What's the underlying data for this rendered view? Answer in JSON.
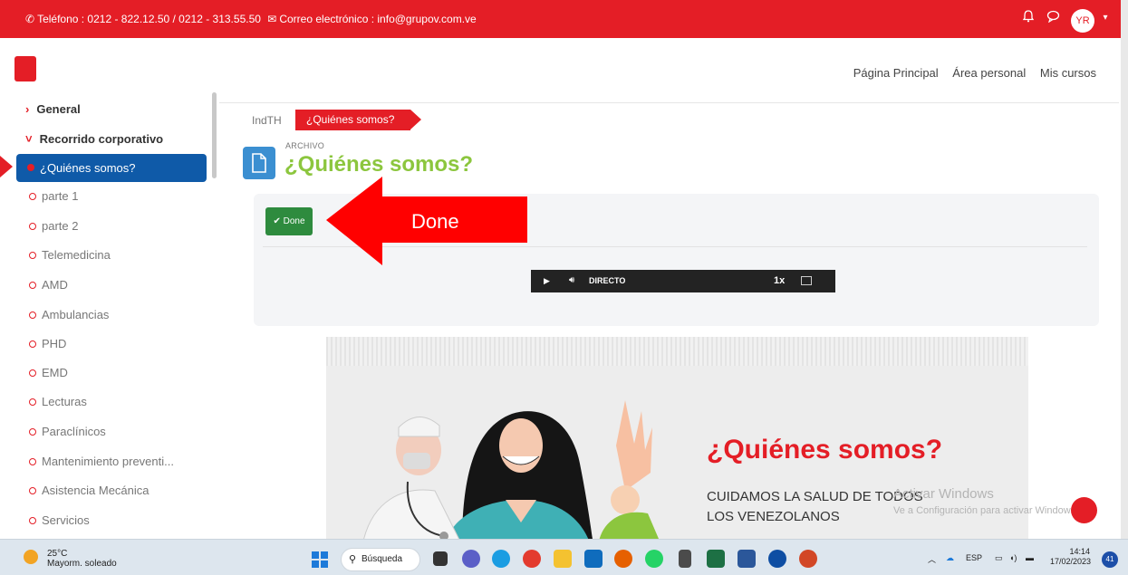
{
  "topbar": {
    "contact": "Teléfono : 0212 - 822.12.50 / 0212 - 313.55.50",
    "email": "Correo electrónico : info@grupov.com.ve",
    "avatar": "YR"
  },
  "nav": {
    "home": "Página Principal",
    "personal": "Área personal",
    "courses": "Mis cursos"
  },
  "sidebar": {
    "sections": [
      "General",
      "Recorrido corporativo"
    ],
    "active": "¿Quiénes somos?",
    "items": [
      "parte 1",
      "parte 2",
      "Telemedicina",
      "AMD",
      "Ambulancias",
      "PHD",
      "EMD",
      "Lecturas",
      "Paraclínicos",
      "Mantenimiento preventi...",
      "Asistencia Mecánica",
      "Servicios"
    ]
  },
  "breadcrumb": {
    "course": "IndTH",
    "current": "¿Quiénes somos?"
  },
  "page": {
    "type_label": "ARCHIVO",
    "title": "¿Quiénes somos?"
  },
  "activity": {
    "done_label": "✔ Done",
    "annotation": "Done"
  },
  "player": {
    "live": "DIRECTO",
    "speed": "1x"
  },
  "hero": {
    "title": "¿Quiénes somos?",
    "subtitle": "CUIDAMOS LA SALUD DE TODOS LOS VENEZOLANOS"
  },
  "watermark": {
    "line1": "Activar Windows",
    "line2": "Ve a Configuración para activar Windows."
  },
  "taskbar": {
    "temp": "25°C",
    "weather": "Mayorm. soleado",
    "search": "Búsqueda",
    "lang": "ESP",
    "time": "14:14",
    "date": "17/02/2023",
    "notif_count": "41"
  },
  "colors": {
    "brand": "#e41e26",
    "active": "#0f5aa8",
    "title": "#8cc63e",
    "done": "#2e8b3e"
  }
}
